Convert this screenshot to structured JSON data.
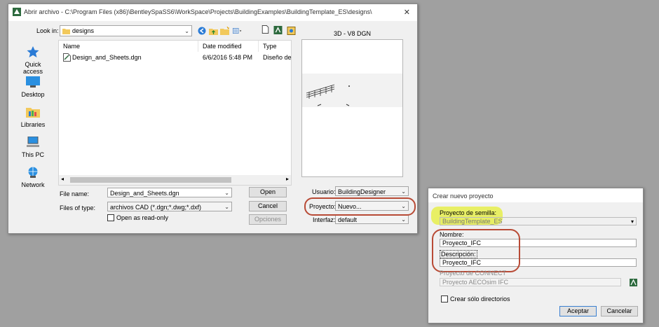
{
  "open_dialog": {
    "title": "Abrir archivo - C:\\Program Files (x86)\\BentleySpaSS6\\WorkSpace\\Projects\\BuildingExamples\\BuildingTemplate_ES\\designs\\",
    "close_glyph": "✕",
    "look_in_label": "Look in:",
    "look_in_value": "designs",
    "places": [
      {
        "label": "Quick access",
        "icon": "star-icon"
      },
      {
        "label": "Desktop",
        "icon": "desktop-icon"
      },
      {
        "label": "Libraries",
        "icon": "libraries-icon"
      },
      {
        "label": "This PC",
        "icon": "computer-icon"
      },
      {
        "label": "Network",
        "icon": "network-icon"
      }
    ],
    "columns": {
      "name": "Name",
      "date": "Date modified",
      "type": "Type"
    },
    "files": [
      {
        "name": "Design_and_Sheets.dgn",
        "date": "6/6/2016 5:48 PM",
        "type": "Diseño de"
      }
    ],
    "preview_title": "3D - V8 DGN",
    "file_name_label": "File name:",
    "file_name_value": "Design_and_Sheets.dgn",
    "files_of_type_label": "Files of type:",
    "files_of_type_value": "archivos CAD (*.dgn;*.dwg;*.dxf)",
    "read_only_label": "Open as read-only",
    "buttons": {
      "open": "Open",
      "cancel": "Cancel",
      "options": "Opciones"
    },
    "usuario_label": "Usuario:",
    "usuario_value": "BuildingDesigner",
    "proyecto_label": "Proyecto:",
    "proyecto_value": "Nuevo...",
    "interfaz_label": "Interfaz:",
    "interfaz_value": "default"
  },
  "new_project_dialog": {
    "title": "Crear nuevo proyecto",
    "seed_label": "Proyecto de semilla:",
    "seed_value": "BuildingTemplate_ES",
    "name_label": "Nombre:",
    "name_value": "Proyecto_IFC",
    "description_label": "Descripción:",
    "description_value": "Proyecto_IFC",
    "connect_label": "Proyecto de CONNECT",
    "connect_value": "Proyecto AECOsim IFC",
    "dirs_only_label": "Crear sólo directorios",
    "accept": "Aceptar",
    "cancel": "Cancelar"
  },
  "colors": {
    "annotation": "#b84a35",
    "highlight": "#e6ee4c",
    "accent": "#3a7fd0"
  }
}
